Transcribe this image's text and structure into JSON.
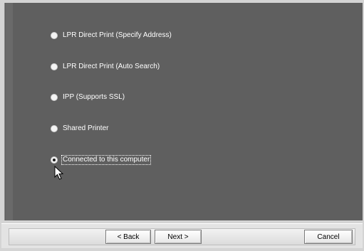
{
  "wizard": {
    "options": [
      {
        "label": "LPR Direct Print (Specify Address)",
        "selected": false,
        "focused": false
      },
      {
        "label": "LPR Direct Print (Auto Search)",
        "selected": false,
        "focused": false
      },
      {
        "label": "IPP (Supports SSL)",
        "selected": false,
        "focused": false
      },
      {
        "label": "Shared Printer",
        "selected": false,
        "focused": false
      },
      {
        "label": "Connected to this computer",
        "selected": true,
        "focused": true
      }
    ]
  },
  "buttons": {
    "back_label": "< Back",
    "next_label": "Next >",
    "cancel_label": "Cancel"
  },
  "colors": {
    "pane_background": "#5f5f5f",
    "label_text": "#ffffff",
    "button_bar": "#e3e3e3"
  },
  "icons": {
    "cursor": "mouse-pointer-icon"
  }
}
